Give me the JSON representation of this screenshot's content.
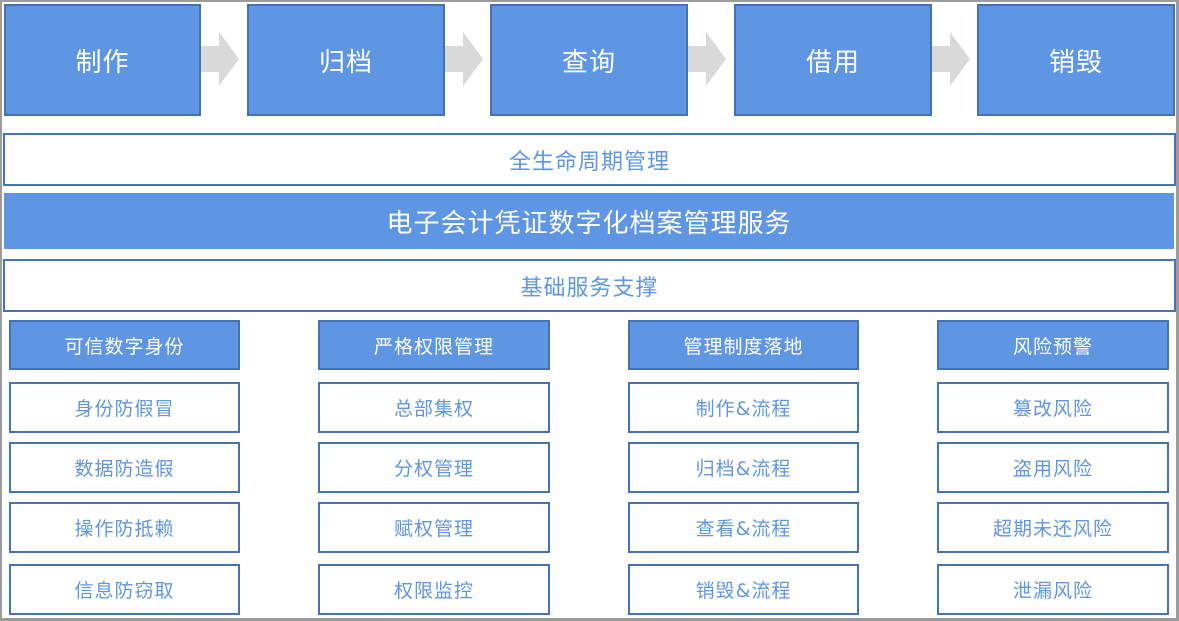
{
  "lifecycle": {
    "stages": [
      {
        "label": "制作"
      },
      {
        "label": "归档"
      },
      {
        "label": "查询"
      },
      {
        "label": "借用"
      },
      {
        "label": "销毁"
      }
    ],
    "arrow_icon": "right-arrow-icon"
  },
  "bands": {
    "lifecycle_management": "全生命周期管理",
    "main_service": "电子会计凭证数字化档案管理服务",
    "foundation_support": "基础服务支撑"
  },
  "columns": [
    {
      "header": "可信数字身份",
      "items": [
        "身份防假冒",
        "数据防造假",
        "操作防抵赖",
        "信息防窃取"
      ]
    },
    {
      "header": "严格权限管理",
      "items": [
        "总部集权",
        "分权管理",
        "赋权管理",
        "权限监控"
      ]
    },
    {
      "header": "管理制度落地",
      "items": [
        "制作&流程",
        "归档&流程",
        "查看&流程",
        "销毁&流程"
      ]
    },
    {
      "header": "风险预警",
      "items": [
        "篡改风险",
        "盗用风险",
        "超期未还风险",
        "泄漏风险"
      ]
    }
  ],
  "colors": {
    "primary_fill": "#5f96e4",
    "border": "#4472b4",
    "arrow": "#d9d9d9",
    "frame": "#9c9c9c"
  }
}
